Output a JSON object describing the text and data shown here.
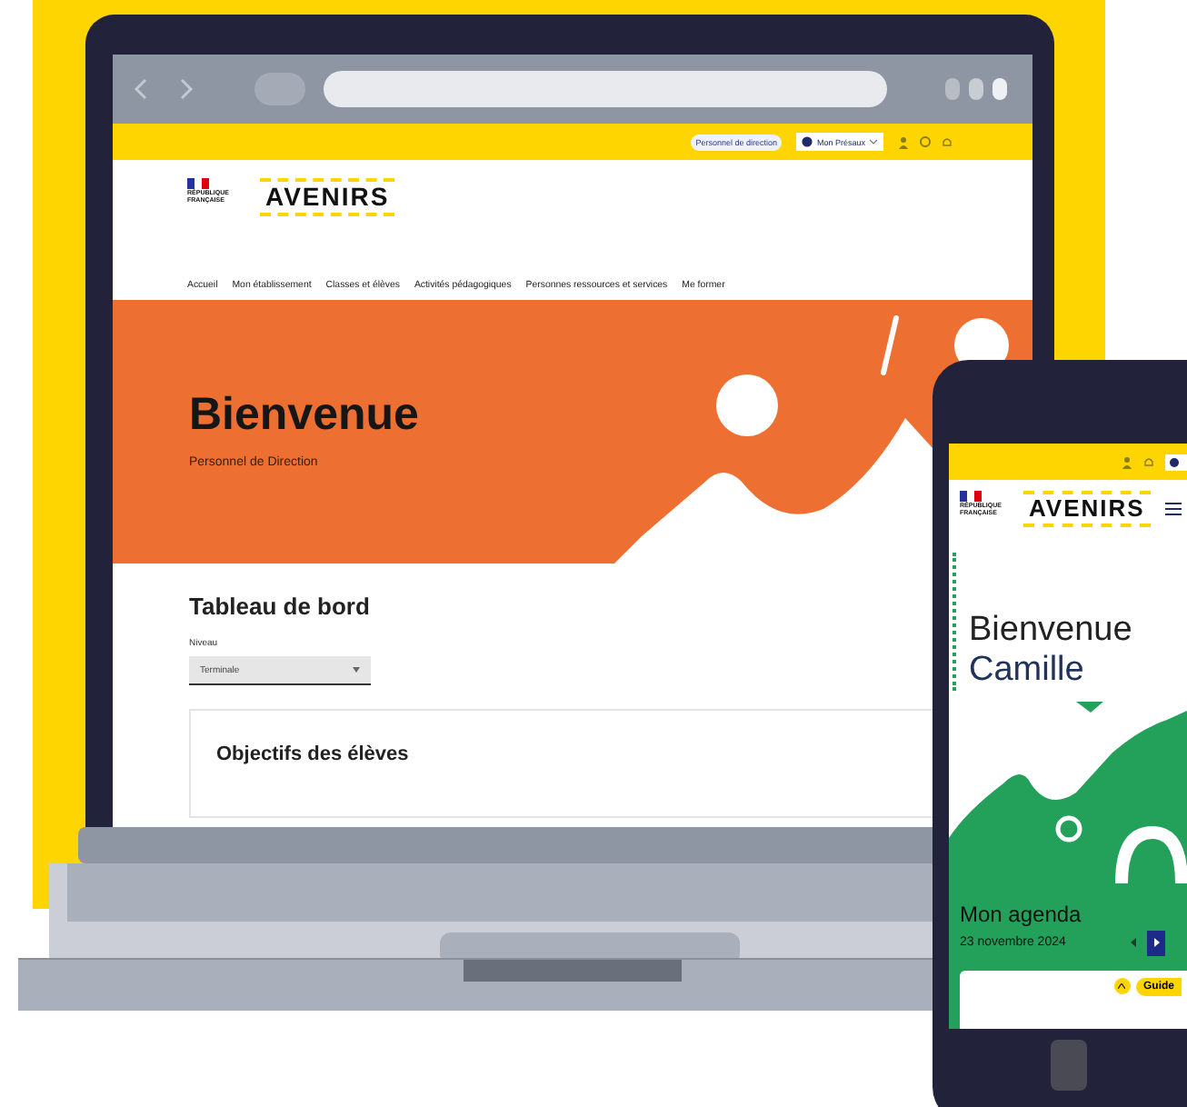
{
  "laptop": {
    "top_bar": {
      "role_chip": "Personnel de direction",
      "user_menu": "Mon Présaux"
    },
    "header": {
      "gov_logo": "RÉPUBLIQUE FRANÇAISE",
      "brand_logo": "AVENIRS"
    },
    "nav": [
      "Accueil",
      "Mon établissement",
      "Classes et élèves",
      "Activités pédagogiques",
      "Personnes ressources et services",
      "Me former"
    ],
    "hero": {
      "title": "Bienvenue",
      "subtitle": "Personnel de Direction"
    },
    "dashboard": {
      "title": "Tableau de bord",
      "level_field": {
        "label": "Niveau",
        "value": "Terminale"
      },
      "card_title": "Objectifs des élèves"
    }
  },
  "phone": {
    "header": {
      "gov_logo": "RÉPUBLIQUE FRANÇAISE",
      "brand_logo": "AVENIRS"
    },
    "greeting": [
      "Bienvenue",
      "Camille"
    ],
    "agenda": {
      "title": "Mon agenda",
      "date": "23 novembre 2024",
      "guide_button": "Guide"
    }
  }
}
